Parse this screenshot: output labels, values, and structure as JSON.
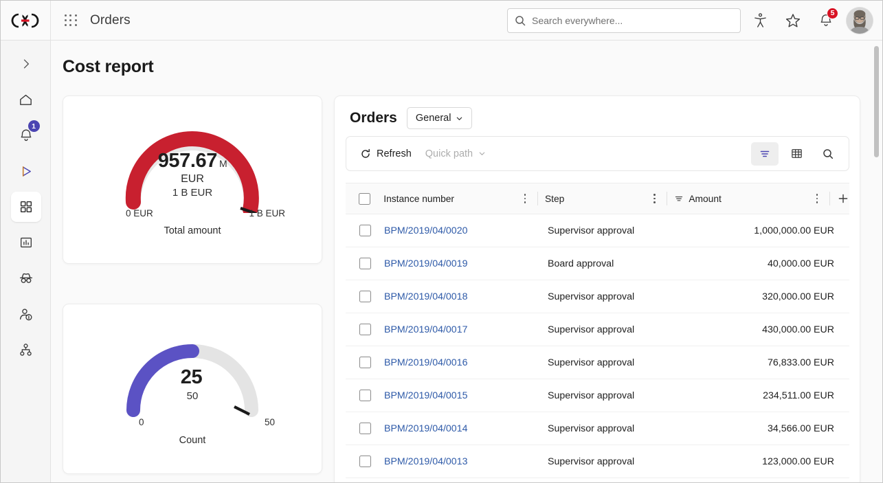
{
  "brand": {
    "logo_name": "cuba-platform-logo",
    "accent_red": "#d81224",
    "accent_purple": "#4b45b2",
    "link_blue": "#2e5aa8"
  },
  "topbar": {
    "app_title": "Orders",
    "waffle_icon": "app-grid-icon",
    "search": {
      "icon": "search-icon",
      "placeholder": "Search everywhere...",
      "value": ""
    },
    "icons": [
      {
        "name": "accessibility-icon",
        "label": "Accessibility"
      },
      {
        "name": "star-icon",
        "label": "Favorites"
      },
      {
        "name": "bell-icon",
        "label": "Notifications",
        "badge": "5"
      }
    ],
    "avatar": {
      "name": "user-avatar",
      "label": "User profile"
    }
  },
  "rail": {
    "items": [
      {
        "name": "expand-icon",
        "label": "Expand menu"
      },
      {
        "name": "home-icon",
        "label": "Home"
      },
      {
        "name": "bell-icon",
        "label": "Notifications",
        "badge": "1"
      },
      {
        "name": "play-icon",
        "label": "Processes"
      },
      {
        "name": "apps-grid-icon",
        "label": "Applications",
        "active": true
      },
      {
        "name": "chart-bar-icon",
        "label": "Reports"
      },
      {
        "name": "incognito-icon",
        "label": "Anonymous"
      },
      {
        "name": "user-info-icon",
        "label": "User details"
      },
      {
        "name": "hierarchy-icon",
        "label": "Organization"
      }
    ]
  },
  "page": {
    "title": "Cost report"
  },
  "chart_data": [
    {
      "type": "gauge",
      "title": "Total amount",
      "value": 957.67,
      "value_display": "957.67",
      "value_suffix": "M",
      "unit": "EUR",
      "target_display": "1 B EUR",
      "min": 0,
      "max": 1000,
      "min_label": "0 EUR",
      "max_label": "1 B EUR",
      "color": "#c8202f",
      "track_color": "#e8e8e8",
      "needle_color": "#1a1a1a",
      "percent": 95.77
    },
    {
      "type": "gauge",
      "title": "Count",
      "value": 25,
      "value_display": "25",
      "value_suffix": "",
      "unit": "",
      "target_display": "50",
      "min": 0,
      "max": 50,
      "min_label": "0",
      "max_label": "50",
      "color": "#5b52c4",
      "track_color": "#e4e4e4",
      "needle_color": "#1a1a1a",
      "percent": 50
    }
  ],
  "orders": {
    "title": "Orders",
    "view_selector": {
      "label": "General",
      "icon": "chevron-down-icon"
    },
    "toolbar": {
      "refresh": {
        "label": "Refresh",
        "icon": "refresh-icon"
      },
      "quick_path": {
        "label": "Quick path",
        "icon": "chevron-down-icon"
      },
      "filter_icon": {
        "name": "filter-icon",
        "active": true
      },
      "table_icon": {
        "name": "table-grid-icon",
        "active": false
      },
      "search_icon": {
        "name": "search-icon",
        "active": false
      }
    },
    "table": {
      "select_all": {
        "name": "select-all-checkbox",
        "checked": false
      },
      "columns": [
        {
          "key": "instance",
          "label": "Instance number",
          "sorted": false
        },
        {
          "key": "step",
          "label": "Step",
          "sorted": false
        },
        {
          "key": "amount",
          "label": "Amount",
          "sorted": true,
          "sort_icon": "sort-descending-icon",
          "align": "right"
        }
      ],
      "add_column_icon": "plus-icon",
      "rows": [
        {
          "instance": "BPM/2019/04/0020",
          "step": "Supervisor approval",
          "amount": "1,000,000.00 EUR"
        },
        {
          "instance": "BPM/2019/04/0019",
          "step": "Board approval",
          "amount": "40,000.00 EUR"
        },
        {
          "instance": "BPM/2019/04/0018",
          "step": "Supervisor approval",
          "amount": "320,000.00 EUR"
        },
        {
          "instance": "BPM/2019/04/0017",
          "step": "Supervisor approval",
          "amount": "430,000.00 EUR"
        },
        {
          "instance": "BPM/2019/04/0016",
          "step": "Supervisor approval",
          "amount": "76,833.00 EUR"
        },
        {
          "instance": "BPM/2019/04/0015",
          "step": "Supervisor approval",
          "amount": "234,511.00 EUR"
        },
        {
          "instance": "BPM/2019/04/0014",
          "step": "Supervisor approval",
          "amount": "34,566.00 EUR"
        },
        {
          "instance": "BPM/2019/04/0013",
          "step": "Supervisor approval",
          "amount": "123,000.00 EUR"
        }
      ]
    }
  },
  "scrollbar": {
    "name": "page-scrollbar"
  }
}
